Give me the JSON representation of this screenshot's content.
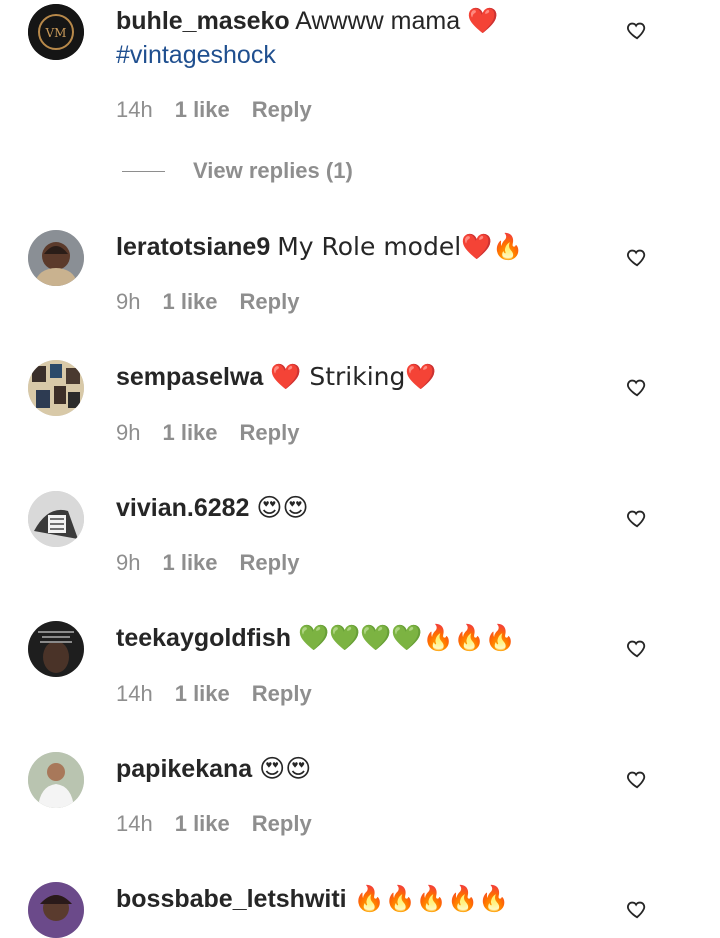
{
  "comments": [
    {
      "username": "buhle_maseko",
      "text": "Awwww mama ❤️",
      "hashtag": "#vintageshock",
      "time": "14h",
      "likes": "1 like",
      "reply": "Reply"
    },
    {
      "username": "leratotsiane9",
      "text": "My Role model❤️🔥",
      "time": "9h",
      "likes": "1 like",
      "reply": "Reply"
    },
    {
      "username": "sempaselwa",
      "text": "❤️ Striking❤️",
      "time": "9h",
      "likes": "1 like",
      "reply": "Reply"
    },
    {
      "username": "vivian.6282",
      "text": "😍😍",
      "time": "9h",
      "likes": "1 like",
      "reply": "Reply"
    },
    {
      "username": "teekaygoldfish",
      "text": "💚💚💚💚🔥🔥🔥",
      "time": "14h",
      "likes": "1 like",
      "reply": "Reply"
    },
    {
      "username": "papikekana",
      "text": "😍😍",
      "time": "14h",
      "likes": "1 like",
      "reply": "Reply"
    },
    {
      "username": "bossbabe_letshwiti",
      "text": "🔥🔥🔥🔥🔥"
    }
  ],
  "view_replies": "View replies (1)",
  "icons": {
    "like": "heart-outline-icon"
  },
  "colors": {
    "hashtag": "#1f4f8f",
    "meta": "#8e8e8e"
  }
}
